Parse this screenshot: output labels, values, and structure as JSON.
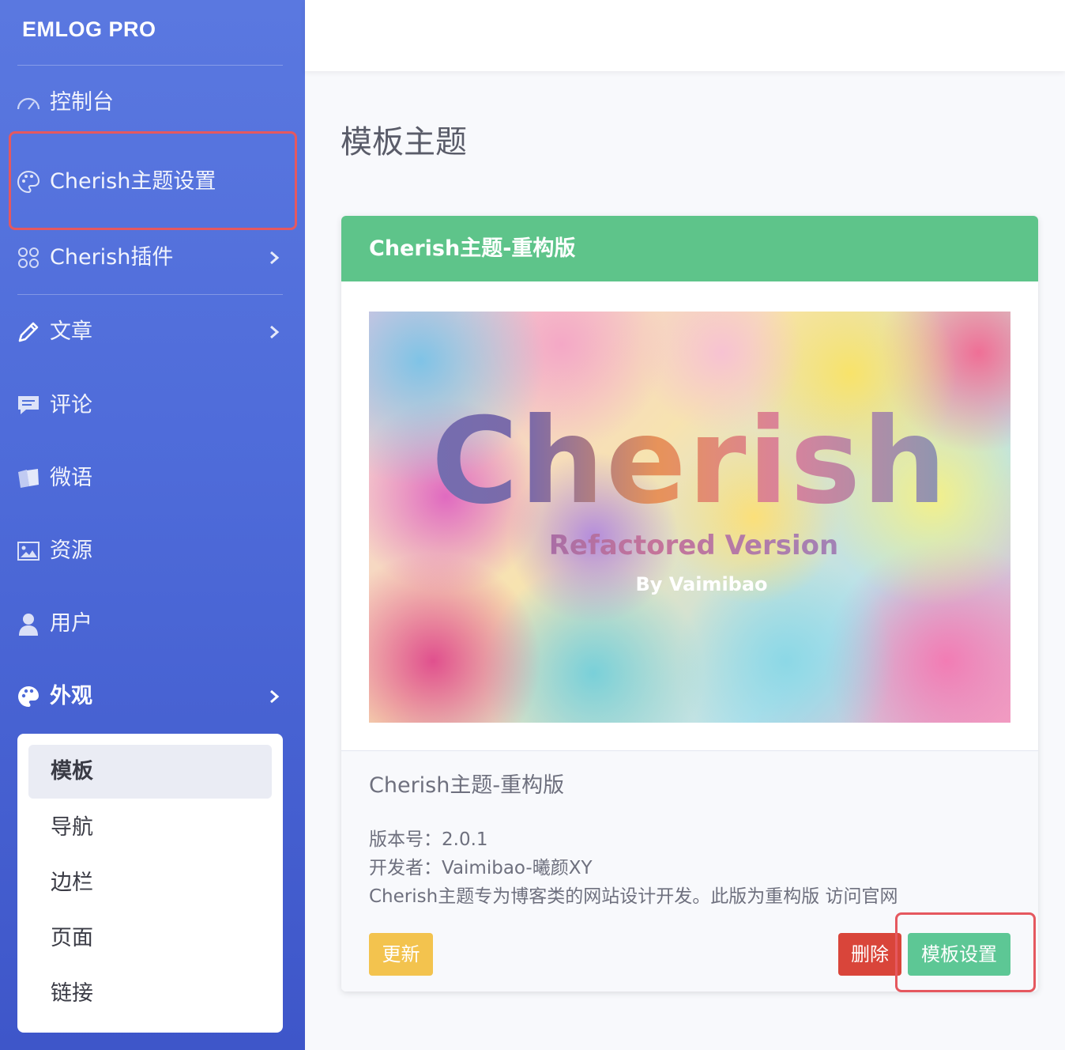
{
  "sidebar": {
    "brand": "EMLOG PRO",
    "items": [
      {
        "label": "控制台"
      },
      {
        "label": "Cherish主题设置"
      },
      {
        "label": "Cherish插件"
      },
      {
        "label": "文章"
      },
      {
        "label": "评论"
      },
      {
        "label": "微语"
      },
      {
        "label": "资源"
      },
      {
        "label": "用户"
      },
      {
        "label": "外观"
      }
    ],
    "submenu": [
      {
        "label": "模板"
      },
      {
        "label": "导航"
      },
      {
        "label": "边栏"
      },
      {
        "label": "页面"
      },
      {
        "label": "链接"
      }
    ]
  },
  "main": {
    "page_title": "模板主题",
    "card": {
      "header": "Cherish主题-重构版",
      "preview": {
        "title": "Cherish",
        "subtitle": "Refactored Version",
        "byline": "By Vaimibao"
      },
      "name": "Cherish主题-重构版",
      "version_label": "版本号：",
      "version": "2.0.1",
      "developer_label": "开发者：",
      "developer": "Vaimibao-曦颜XY",
      "description": "Cherish主题专为博客类的网站设计开发。此版为重构版",
      "website_link": "访问官网",
      "buttons": {
        "update": "更新",
        "delete": "删除",
        "settings": "模板设置"
      }
    }
  },
  "colors": {
    "sidebar": "#4e6bd9",
    "card_header": "#5ec48a",
    "update_button": "#f3c34e",
    "delete_button": "#d9453a",
    "settings_button": "#5dc795",
    "highlight": "#e5585f"
  }
}
